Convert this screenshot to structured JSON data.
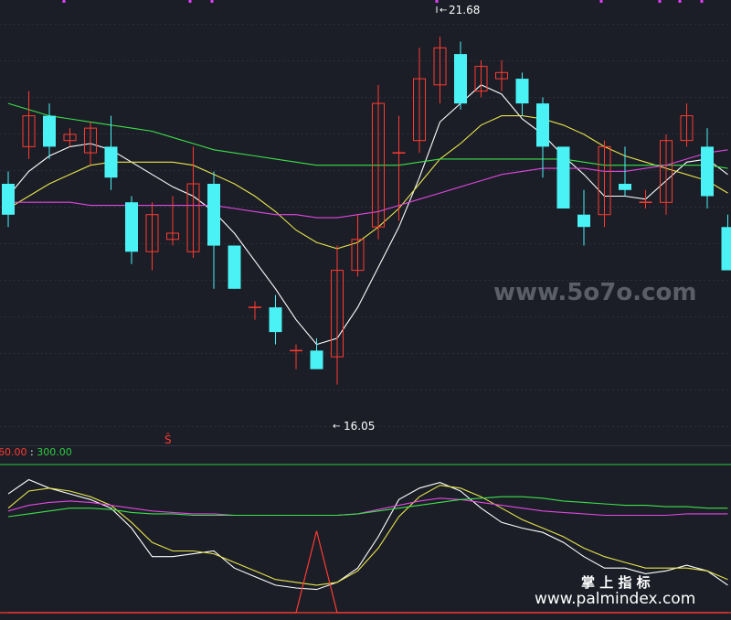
{
  "chart_data": {
    "type": "candlestick",
    "price_range": [
      15.2,
      22.2
    ],
    "candles": [
      {
        "o": 19.3,
        "c": 18.8,
        "h": 19.5,
        "l": 18.6
      },
      {
        "o": 19.9,
        "c": 20.4,
        "h": 20.8,
        "l": 19.7
      },
      {
        "o": 20.4,
        "c": 19.9,
        "h": 20.6,
        "l": 19.7
      },
      {
        "o": 20.0,
        "c": 20.1,
        "h": 20.2,
        "l": 19.9
      },
      {
        "o": 19.8,
        "c": 20.2,
        "h": 20.3,
        "l": 19.6
      },
      {
        "o": 19.9,
        "c": 19.4,
        "h": 20.4,
        "l": 19.2
      },
      {
        "o": 19.0,
        "c": 18.2,
        "h": 19.1,
        "l": 18.0
      },
      {
        "o": 18.2,
        "c": 18.8,
        "h": 19.0,
        "l": 17.9
      },
      {
        "o": 18.4,
        "c": 18.5,
        "h": 19.1,
        "l": 18.3
      },
      {
        "o": 18.2,
        "c": 19.3,
        "h": 19.9,
        "l": 18.1
      },
      {
        "o": 19.3,
        "c": 18.3,
        "h": 19.5,
        "l": 17.6
      },
      {
        "o": 18.3,
        "c": 17.6,
        "h": 18.3,
        "l": 17.6
      },
      {
        "o": 17.3,
        "c": 17.3,
        "h": 17.4,
        "l": 17.1
      },
      {
        "o": 17.3,
        "c": 16.9,
        "h": 17.5,
        "l": 16.7
      },
      {
        "o": 16.6,
        "c": 16.6,
        "h": 16.7,
        "l": 16.3
      },
      {
        "o": 16.6,
        "c": 16.3,
        "h": 16.8,
        "l": 16.3
      },
      {
        "o": 16.5,
        "c": 17.9,
        "h": 18.3,
        "l": 16.05
      },
      {
        "o": 17.9,
        "c": 18.4,
        "h": 18.8,
        "l": 17.8
      },
      {
        "o": 18.6,
        "c": 20.6,
        "h": 20.9,
        "l": 18.4
      },
      {
        "o": 19.8,
        "c": 19.8,
        "h": 20.4,
        "l": 18.7
      },
      {
        "o": 20.0,
        "c": 21.0,
        "h": 21.5,
        "l": 19.8
      },
      {
        "o": 20.9,
        "c": 21.5,
        "h": 21.68,
        "l": 20.6
      },
      {
        "o": 21.4,
        "c": 20.6,
        "h": 21.6,
        "l": 20.5
      },
      {
        "o": 20.8,
        "c": 21.2,
        "h": 21.3,
        "l": 20.7
      },
      {
        "o": 21.0,
        "c": 21.1,
        "h": 21.3,
        "l": 20.8
      },
      {
        "o": 21.0,
        "c": 20.6,
        "h": 21.1,
        "l": 20.4
      },
      {
        "o": 20.6,
        "c": 19.9,
        "h": 20.7,
        "l": 19.4
      },
      {
        "o": 19.9,
        "c": 18.9,
        "h": 19.9,
        "l": 18.9
      },
      {
        "o": 18.8,
        "c": 18.6,
        "h": 19.2,
        "l": 18.3
      },
      {
        "o": 18.8,
        "c": 19.9,
        "h": 20.0,
        "l": 18.6
      },
      {
        "o": 19.3,
        "c": 19.2,
        "h": 19.9,
        "l": 19.1
      },
      {
        "o": 19.0,
        "c": 19.0,
        "h": 19.2,
        "l": 18.9
      },
      {
        "o": 19.0,
        "c": 20.0,
        "h": 20.1,
        "l": 18.8
      },
      {
        "o": 20.0,
        "c": 20.4,
        "h": 20.6,
        "l": 19.9
      },
      {
        "o": 19.9,
        "c": 19.1,
        "h": 20.2,
        "l": 18.9
      },
      {
        "o": 18.6,
        "c": 17.9,
        "h": 18.8,
        "l": 17.9
      }
    ],
    "ma_lines": [
      {
        "color": "#ffffff",
        "values": [
          19.1,
          19.5,
          19.75,
          19.9,
          19.95,
          19.85,
          19.65,
          19.45,
          19.25,
          19.1,
          18.85,
          18.5,
          18.05,
          17.6,
          17.1,
          16.7,
          16.8,
          17.3,
          17.95,
          18.6,
          19.4,
          20.3,
          20.6,
          20.9,
          20.75,
          20.35,
          20.1,
          19.75,
          19.45,
          19.1,
          19.1,
          19.05,
          19.35,
          19.65,
          19.7,
          19.45
        ]
      },
      {
        "color": "#e8e44c",
        "values": [
          18.9,
          19.1,
          19.3,
          19.45,
          19.6,
          19.65,
          19.65,
          19.65,
          19.65,
          19.6,
          19.45,
          19.3,
          19.1,
          18.85,
          18.55,
          18.35,
          18.25,
          18.35,
          18.6,
          18.9,
          19.3,
          19.7,
          19.95,
          20.25,
          20.4,
          20.4,
          20.35,
          20.25,
          20.1,
          19.9,
          19.75,
          19.65,
          19.55,
          19.45,
          19.35,
          19.15
        ]
      },
      {
        "color": "#3de04a",
        "values": [
          20.6,
          20.5,
          20.4,
          20.35,
          20.3,
          20.25,
          20.2,
          20.15,
          20.05,
          19.95,
          19.85,
          19.8,
          19.75,
          19.7,
          19.65,
          19.6,
          19.6,
          19.6,
          19.6,
          19.6,
          19.65,
          19.7,
          19.7,
          19.7,
          19.7,
          19.7,
          19.7,
          19.7,
          19.65,
          19.6,
          19.6,
          19.6,
          19.6,
          19.6,
          19.6,
          19.55
        ]
      },
      {
        "color": "#e048e0",
        "values": [
          19.0,
          19.0,
          19.0,
          19.0,
          18.95,
          18.95,
          18.95,
          18.95,
          18.95,
          18.95,
          18.95,
          18.9,
          18.85,
          18.8,
          18.8,
          18.75,
          18.75,
          18.8,
          18.85,
          18.95,
          19.05,
          19.15,
          19.25,
          19.35,
          19.45,
          19.5,
          19.55,
          19.55,
          19.55,
          19.5,
          19.5,
          19.55,
          19.6,
          19.7,
          19.8,
          19.85
        ]
      }
    ],
    "annotations": {
      "high_label": "21.68",
      "low_label": "16.05",
      "signal_glyph": "Ŝ"
    },
    "indicator": {
      "range": [
        0,
        100
      ],
      "header_red": "60.00",
      "header_sep": " : ",
      "header_green": "300.00",
      "lines": [
        {
          "color": "#ffffff",
          "values": [
            82,
            92,
            86,
            82,
            78,
            72,
            58,
            38,
            38,
            40,
            42,
            30,
            24,
            18,
            16,
            15,
            20,
            30,
            52,
            78,
            86,
            90,
            84,
            72,
            62,
            58,
            55,
            48,
            38,
            30,
            30,
            26,
            28,
            32,
            28,
            18
          ]
        },
        {
          "color": "#e8e44c",
          "values": [
            72,
            84,
            86,
            84,
            80,
            74,
            62,
            48,
            42,
            42,
            40,
            34,
            28,
            22,
            20,
            18,
            20,
            28,
            44,
            66,
            80,
            88,
            86,
            80,
            72,
            64,
            58,
            52,
            44,
            38,
            34,
            30,
            30,
            30,
            28,
            22
          ]
        },
        {
          "color": "#e048e0",
          "values": [
            70,
            74,
            76,
            77,
            76,
            74,
            72,
            70,
            69,
            68,
            68,
            67,
            67,
            67,
            67,
            67,
            67,
            68,
            71,
            74,
            77,
            79,
            78,
            76,
            74,
            72,
            70,
            69,
            68,
            67,
            67,
            67,
            67,
            68,
            68,
            68
          ]
        },
        {
          "color": "#3de04a",
          "values": [
            66,
            68,
            70,
            72,
            72,
            71,
            69,
            68,
            68,
            67,
            67,
            67,
            67,
            67,
            67,
            67,
            67,
            68,
            70,
            72,
            74,
            76,
            78,
            79,
            80,
            80,
            79,
            77,
            76,
            75,
            74,
            74,
            73,
            73,
            72,
            72
          ]
        }
      ],
      "spike_values": [
        0,
        0,
        0,
        0,
        0,
        0,
        0,
        0,
        0,
        0,
        0,
        0,
        0,
        0,
        0,
        56,
        0,
        0,
        0,
        0,
        0,
        0,
        0,
        0,
        0,
        0,
        0,
        0,
        0,
        0,
        0,
        0,
        0,
        0,
        0,
        0
      ]
    }
  },
  "watermarks": {
    "site_top": "www.5o7o.com",
    "brand_cn": "掌 上 指 标",
    "site_bottom": "www.palmindex.com"
  },
  "colors": {
    "background": "#1b1e27",
    "up": "#ff3b30",
    "down": "#4af2f5",
    "separator_green": "#2ecc40",
    "accent_magenta": "#e040fb"
  }
}
